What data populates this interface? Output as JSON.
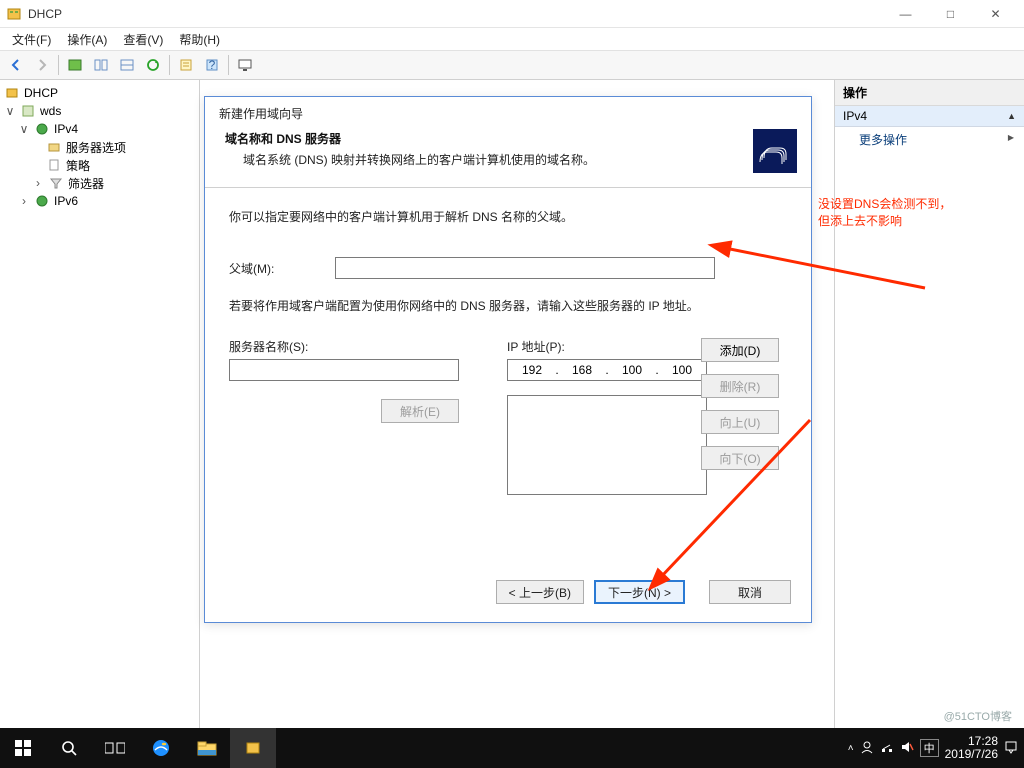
{
  "window": {
    "title": "DHCP",
    "menu": {
      "file": "文件(F)",
      "action": "操作(A)",
      "view": "查看(V)",
      "help": "帮助(H)"
    },
    "winbtn": {
      "min": "—",
      "max": "□",
      "close": "✕"
    }
  },
  "tree": {
    "root": "DHCP",
    "server": "wds",
    "ipv4": "IPv4",
    "server_options": "服务器选项",
    "policies": "策略",
    "filters": "筛选器",
    "ipv6": "IPv6"
  },
  "actions": {
    "header": "操作",
    "group": "IPv4",
    "more": "更多操作"
  },
  "wizard": {
    "title": "新建作用域向导",
    "heading": "域名称和 DNS 服务器",
    "subtitle": "域名系统 (DNS) 映射并转换网络上的客户端计算机使用的域名称。",
    "desc1": "你可以指定要网络中的客户端计算机用于解析 DNS 名称的父域。",
    "parent_label": "父域(M):",
    "parent_value": "",
    "desc2": "若要将作用域客户端配置为使用你网络中的 DNS 服务器，请输入这些服务器的 IP 地址。",
    "servername_label": "服务器名称(S):",
    "servername_value": "",
    "resolve_label": "解析(E)",
    "ip_label": "IP 地址(P):",
    "ip_octets": [
      "192",
      "168",
      "100",
      "100"
    ],
    "btn_add": "添加(D)",
    "btn_remove": "删除(R)",
    "btn_up": "向上(U)",
    "btn_down": "向下(O)",
    "btn_back": "< 上一步(B)",
    "btn_next": "下一步(N) >",
    "btn_cancel": "取消"
  },
  "annotation": {
    "line1": "没设置DNS会检测不到，",
    "line2": "但添上去不影响"
  },
  "taskbar": {
    "time": "17:28",
    "date": "2019/7/26",
    "ime": "中"
  },
  "watermark": "@51CTO博客"
}
